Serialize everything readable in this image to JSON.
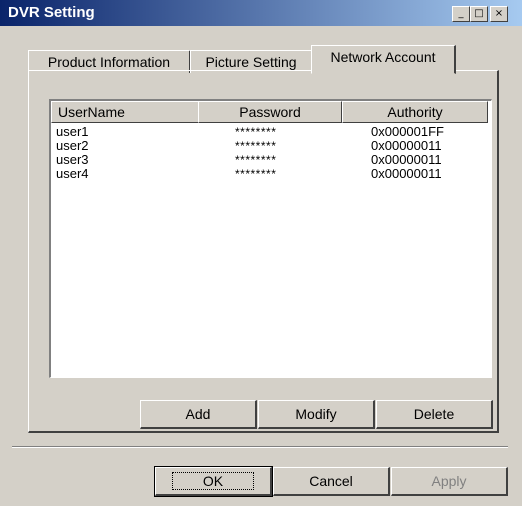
{
  "window": {
    "title": "DVR Setting"
  },
  "titlebar_buttons": {
    "minimize": "_",
    "maximize": "□",
    "close": "×"
  },
  "tabs": [
    {
      "label": "Product Information"
    },
    {
      "label": "Picture Setting"
    },
    {
      "label": "Network Account",
      "active": true
    }
  ],
  "table": {
    "columns": [
      "UserName",
      "Password",
      "Authority"
    ],
    "rows": [
      {
        "user": "user1",
        "password": "********",
        "authority": "0x000001FF"
      },
      {
        "user": "user2",
        "password": "********",
        "authority": "0x00000011"
      },
      {
        "user": "user3",
        "password": "********",
        "authority": "0x00000011"
      },
      {
        "user": "user4",
        "password": "********",
        "authority": "0x00000011"
      }
    ]
  },
  "account_buttons": {
    "add": "Add",
    "modify": "Modify",
    "delete": "Delete"
  },
  "dialog_buttons": {
    "ok": "OK",
    "cancel": "Cancel",
    "apply": "Apply"
  }
}
